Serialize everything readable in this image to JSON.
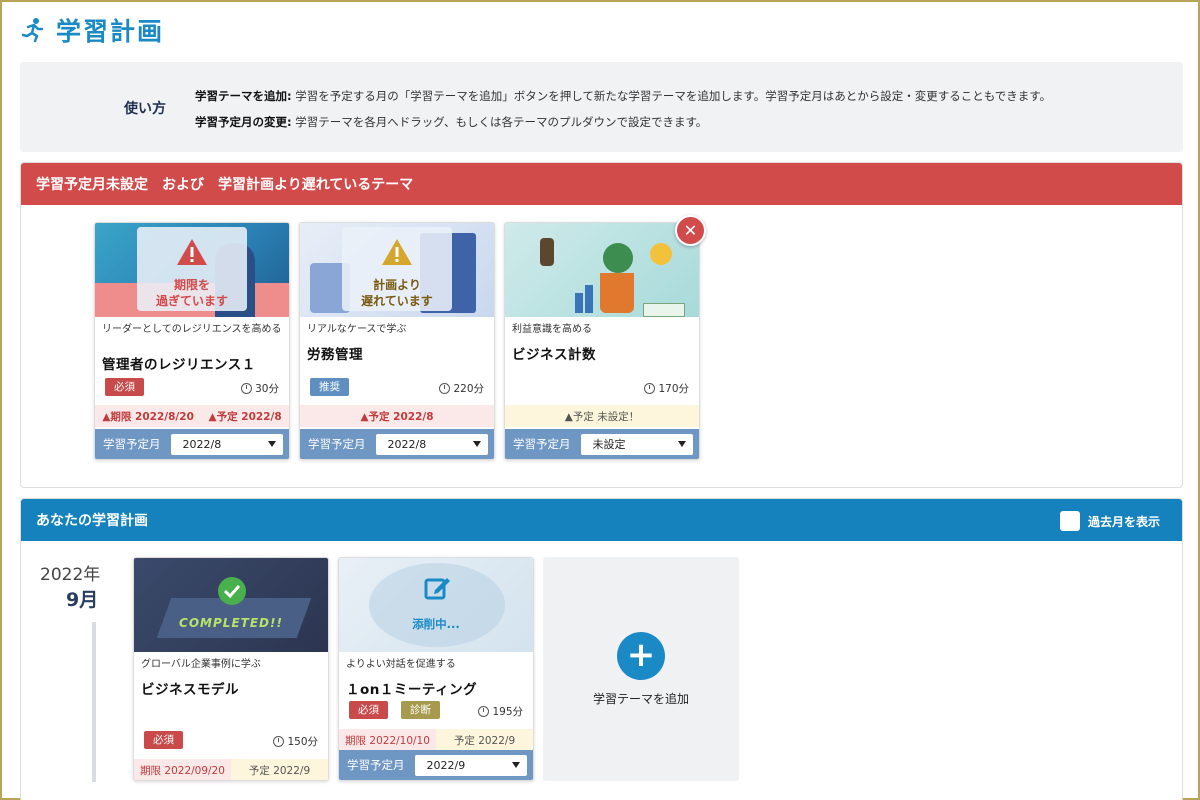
{
  "page": {
    "title": "学習計画"
  },
  "howto": {
    "label": "使い方",
    "line1_key": "学習テーマを追加:",
    "line1_text": "学習を予定する月の「学習テーマを追加」ボタンを押して新たな学習テーマを追加します。学習予定月はあとから設定・変更することもできます。",
    "line2_key": "学習予定月の変更:",
    "line2_text": "学習テーマを各月へドラッグ、もしくは各テーマのプルダウンで設定できます。"
  },
  "overdue": {
    "title": "学習予定月未設定　および　学習計画より遅れているテーマ",
    "cards": [
      {
        "overlay": "期限を\n過ぎています",
        "subtitle": "リーダーとしてのレジリエンスを高める",
        "title": "管理者のレジリエンス１",
        "tag": "必須",
        "duration": "30分",
        "warn1": "▲期限 2022/8/20",
        "warn2": "▲予定 2022/8",
        "sched_label": "学習予定月",
        "sched_value": "2022/8"
      },
      {
        "overlay": "計画より\n遅れています",
        "subtitle": "リアルなケースで学ぶ",
        "title": "労務管理",
        "tag": "推奨",
        "duration": "220分",
        "warn1": "▲予定 2022/8",
        "sched_label": "学習予定月",
        "sched_value": "2022/8"
      },
      {
        "subtitle": "利益意識を高める",
        "title": "ビジネス計数",
        "duration": "170分",
        "warn1": "▲予定 未設定！",
        "sched_label": "学習予定月",
        "sched_value": "未設定"
      }
    ]
  },
  "plan": {
    "title": "あなたの学習計画",
    "show_past_label": "過去月を表示",
    "year": "2022年",
    "month": "9月",
    "cards": [
      {
        "badge": "COMPLETED!!",
        "subtitle": "グローバル企業事例に学ぶ",
        "title": "ビジネスモデル",
        "tag": "必須",
        "duration": "150分",
        "deadline": "期限 2022/09/20",
        "planned": "予定 2022/9"
      },
      {
        "badge": "添削中...",
        "subtitle": "よりよい対話を促進する",
        "title": "１on１ミーティング",
        "tag1": "必須",
        "tag2": "診断",
        "duration": "195分",
        "deadline": "期限 2022/10/10",
        "planned": "予定 2022/9",
        "sched_label": "学習予定月",
        "sched_value": "2022/9"
      }
    ],
    "add_label": "学習テーマを追加"
  },
  "colors": {
    "accent": "#1a8ac6",
    "danger": "#d24b4b",
    "plan_header": "#1582bd"
  }
}
